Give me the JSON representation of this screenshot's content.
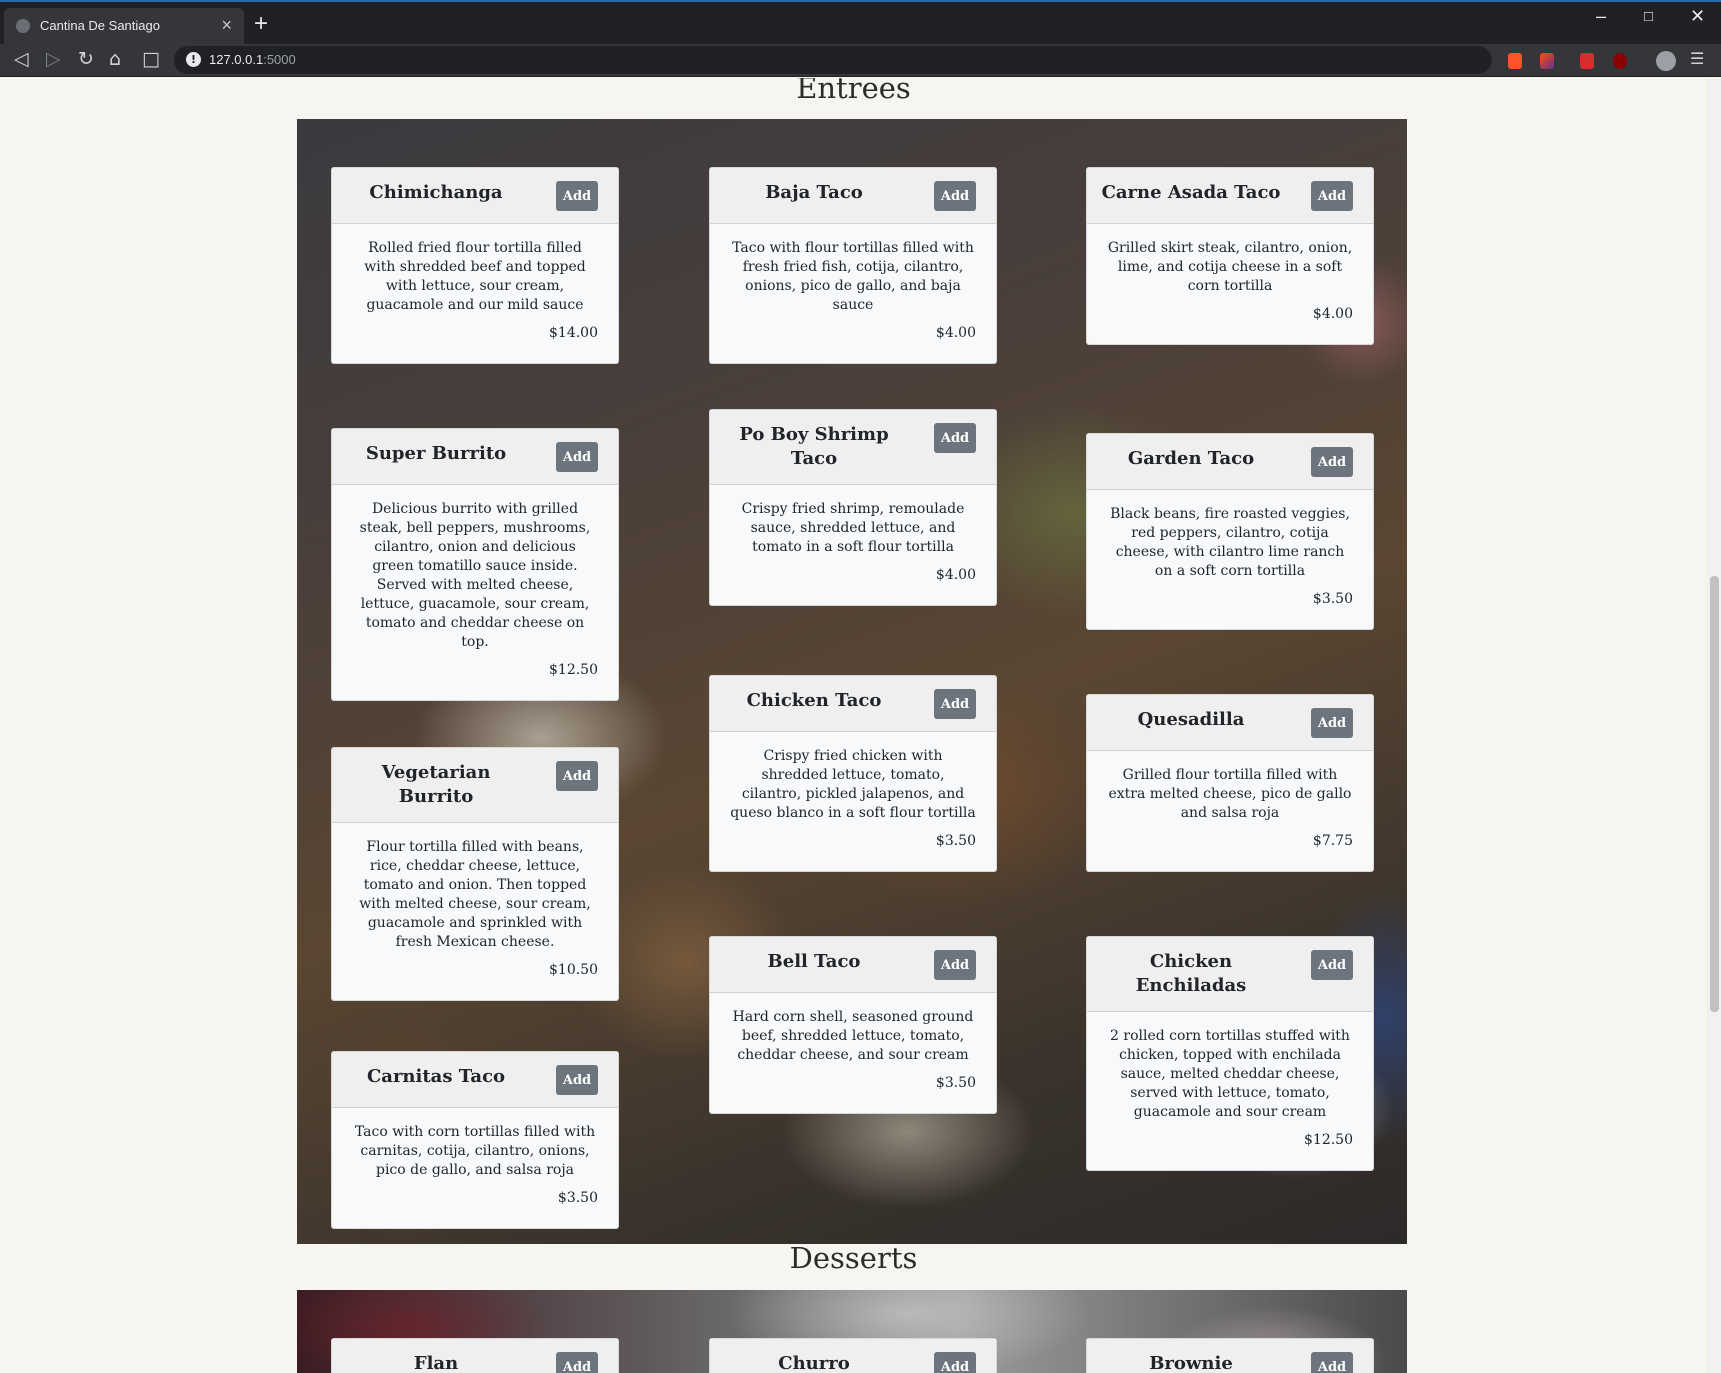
{
  "browser": {
    "tab_title": "Cantina De Santiago",
    "tab_close": "×",
    "new_tab": "+",
    "url_host": "127.0.0.1",
    "url_port": ":5000"
  },
  "sections": {
    "entrees_title": "Entrees",
    "desserts_title": "Desserts"
  },
  "entrees": [
    {
      "name": "Chimichanga",
      "desc": "Rolled fried flour tortilla filled with shredded beef and topped with lettuce, sour cream, guacamole and our mild sauce",
      "price": "$14.00",
      "add": "Add"
    },
    {
      "name": "Baja Taco",
      "desc": "Taco with flour tortillas filled with fresh fried fish, cotija, cilantro, onions, pico de gallo, and baja sauce",
      "price": "$4.00",
      "add": "Add"
    },
    {
      "name": "Carne Asada Taco",
      "desc": "Grilled skirt steak, cilantro, onion, lime, and cotija cheese in a soft corn tortilla",
      "price": "$4.00",
      "add": "Add"
    },
    {
      "name": "Super Burrito",
      "desc": "Delicious burrito with grilled steak, bell peppers, mushrooms, cilantro, onion and delicious green tomatillo sauce inside. Served with melted cheese, lettuce, guacamole, sour cream, tomato and cheddar cheese on top.",
      "price": "$12.50",
      "add": "Add"
    },
    {
      "name": "Po Boy Shrimp Taco",
      "desc": "Crispy fried shrimp, remoulade sauce, shredded lettuce, and tomato in a soft flour tortilla",
      "price": "$4.00",
      "add": "Add"
    },
    {
      "name": "Garden Taco",
      "desc": "Black beans, fire roasted veggies, red peppers, cilantro, cotija cheese, with cilantro lime ranch on a soft corn tortilla",
      "price": "$3.50",
      "add": "Add"
    },
    {
      "name": "Chicken Taco",
      "desc": "Crispy fried chicken with shredded lettuce, tomato, cilantro, pickled jalapenos, and queso blanco in a soft flour tortilla",
      "price": "$3.50",
      "add": "Add"
    },
    {
      "name": "Quesadilla",
      "desc": "Grilled flour tortilla filled with extra melted cheese, pico de gallo and salsa roja",
      "price": "$7.75",
      "add": "Add"
    },
    {
      "name": "Vegetarian Burrito",
      "desc": "Flour tortilla filled with beans, rice, cheddar cheese, lettuce, tomato and onion. Then topped with melted cheese, sour cream, guacamole and sprinkled with fresh Mexican cheese.",
      "price": "$10.50",
      "add": "Add"
    },
    {
      "name": "Bell Taco",
      "desc": "Hard corn shell, seasoned ground beef, shredded lettuce, tomato, cheddar cheese, and sour cream",
      "price": "$3.50",
      "add": "Add"
    },
    {
      "name": "Chicken Enchiladas",
      "desc": "2 rolled corn tortillas stuffed with chicken, topped with enchilada sauce, melted cheddar cheese, served with lettuce, tomato, guacamole and sour cream",
      "price": "$12.50",
      "add": "Add"
    },
    {
      "name": "Carnitas Taco",
      "desc": "Taco with corn tortillas filled with carnitas, cotija, cilantro, onions, pico de gallo, and salsa roja",
      "price": "$3.50",
      "add": "Add"
    }
  ],
  "desserts": [
    {
      "name": "Flan",
      "add": "Add"
    },
    {
      "name": "Churro",
      "add": "Add"
    },
    {
      "name": "Brownie",
      "add": "Add"
    }
  ]
}
